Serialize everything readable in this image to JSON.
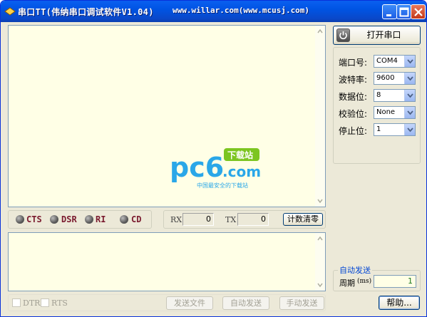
{
  "window": {
    "title": "串口TT(伟纳串口调试软件V1.04)",
    "url_text": "www.willar.com(www.mcusj.com)"
  },
  "watermark": {
    "brand": "pc6",
    "domain": ".com",
    "badge": "下载站",
    "slogan": "中国最安全的下载站"
  },
  "signals": [
    "CTS",
    "DSR",
    "RI",
    "CD"
  ],
  "counters": {
    "rx_label": "RX",
    "rx_value": "0",
    "tx_label": "TX",
    "tx_value": "0",
    "reset_label": "计数清零"
  },
  "serial": {
    "open_label": "打开串口",
    "params": [
      {
        "label": "端口号:",
        "value": "COM4"
      },
      {
        "label": "波特率:",
        "value": "9600"
      },
      {
        "label": "数据位:",
        "value": "8"
      },
      {
        "label": "校验位:",
        "value": "None"
      },
      {
        "label": "停止位:",
        "value": "1"
      }
    ]
  },
  "auto_send": {
    "title": "自动发送",
    "period_label": "周期",
    "period_unit": "(ms)",
    "period_value": "1"
  },
  "bottom": {
    "dtr": "DTR",
    "rts": "RTS",
    "send_file": "发送文件",
    "auto_send": "自动发送",
    "manual_send": "手动发送",
    "help": "帮助..."
  },
  "colors": {
    "title_bar": "#0054e3",
    "text_area_bg": "#ffffe6",
    "signal_text": "#7a1a2e",
    "logo_blue": "#2aa7e8",
    "logo_green": "#7cc520"
  }
}
